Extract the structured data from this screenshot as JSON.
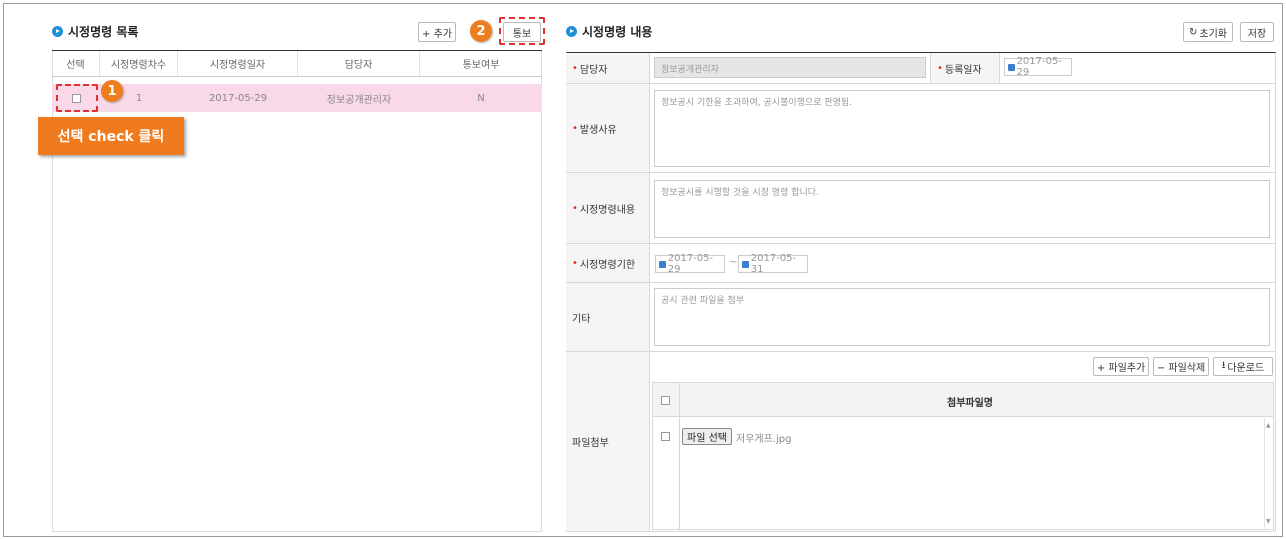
{
  "left": {
    "title": "시정명령 목록",
    "add_button": "+ 추가",
    "notify_button": "통보",
    "columns": [
      "선택",
      "시정명령차수",
      "시정명령일자",
      "담당자",
      "통보여부"
    ],
    "rows": [
      {
        "round": "1",
        "date": "2017-05-29",
        "manager": "정보공개관리자",
        "notified": "N"
      }
    ]
  },
  "annotations": {
    "step1": "1",
    "step2": "2",
    "callout": "선택 check 클릭",
    "accent_color": "#f07b1e",
    "dash_color": "#e03030"
  },
  "right": {
    "title": "시정명령 내용",
    "reset_button": "초기화",
    "save_button": "저장",
    "manager_label": "담당자",
    "manager_value": "정보공개관리자",
    "regdate_label": "등록일자",
    "regdate_value": "2017-05-29",
    "reason_label": "발생사유",
    "reason_value": "정보공시 기한을 초과하여, 공시불이행으로 판명됨.",
    "content_label": "시정명령내용",
    "content_value": "정보공시를 시행할 것을 시정 명령 합니다.",
    "period_label": "시정명령기한",
    "period_start": "2017-05-29",
    "period_sep": "~",
    "period_end": "2017-05-31",
    "etc_label": "기타",
    "etc_value": "공시 관련 파일을 첨부",
    "attach_label": "파일첨부",
    "file_add": "+ 파일추가",
    "file_delete": "− 파일삭제",
    "download": "다운로드",
    "file_col": "첨부파일명",
    "file_choose": "파일 선택",
    "file_name": "저우게프.jpg"
  }
}
